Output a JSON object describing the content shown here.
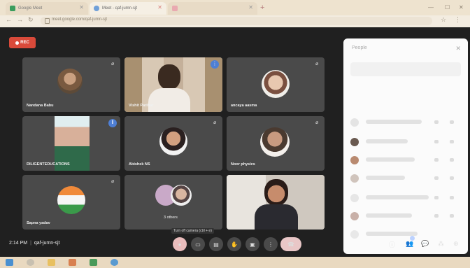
{
  "browser": {
    "tabs": [
      {
        "label": "Google Meet",
        "active": false
      },
      {
        "label": "Meet - qaf-jumn-sjt",
        "active": true
      },
      {
        "label": "",
        "active": false
      }
    ],
    "url": "meet.google.com/qaf-jumn-sjt"
  },
  "meeting": {
    "rec_label": "REC",
    "time": "2:14 PM",
    "code": "qaf-jumn-sjt",
    "tooltip": "Turn off camera (ctrl + e)",
    "participants": [
      {
        "name": "Nandana Babu"
      },
      {
        "name": "Vishit Parihar"
      },
      {
        "name": "ancaya aasma"
      },
      {
        "name": "DILIGENTEDUCATIONS"
      },
      {
        "name": "Abishek NS"
      },
      {
        "name": "Noor physics"
      },
      {
        "name": "Sapna yadav"
      },
      {
        "name": "3 others"
      },
      {
        "name": ""
      }
    ]
  },
  "panel": {
    "title": "People"
  },
  "colors": {
    "tile": "#4a4a4a",
    "background": "#202020",
    "rec": "#d94a3a"
  }
}
